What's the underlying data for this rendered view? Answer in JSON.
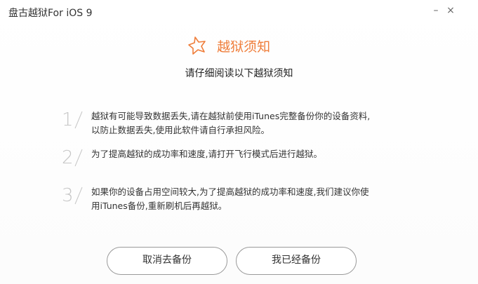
{
  "window": {
    "title": "盘古越狱For iOS 9",
    "minimize_label": "–",
    "close_label": "×"
  },
  "header": {
    "title": "越狱须知",
    "icon": "star-outline-icon",
    "accent_color": "#ef7d3a"
  },
  "subtitle": "请仔细阅读以下越狱须知",
  "notices": [
    {
      "number": "1",
      "line1": "越狱有可能导致数据丢失,请在越狱前使用iTunes完整备份你的设备资料,",
      "line2": "以防止数据丢失,使用此软件请自行承担风险。"
    },
    {
      "number": "2",
      "line1": "为了提高越狱的成功率和速度,请打开飞行模式后进行越狱。",
      "line2": ""
    },
    {
      "number": "3",
      "line1": "如果你的设备占用空间较大,为了提高越狱的成功率和速度,我们建议你使",
      "line2": "用iTunes备份,重新刷机后再越狱。"
    }
  ],
  "buttons": {
    "cancel_label": "取消去备份",
    "confirm_label": "我已经备份"
  }
}
